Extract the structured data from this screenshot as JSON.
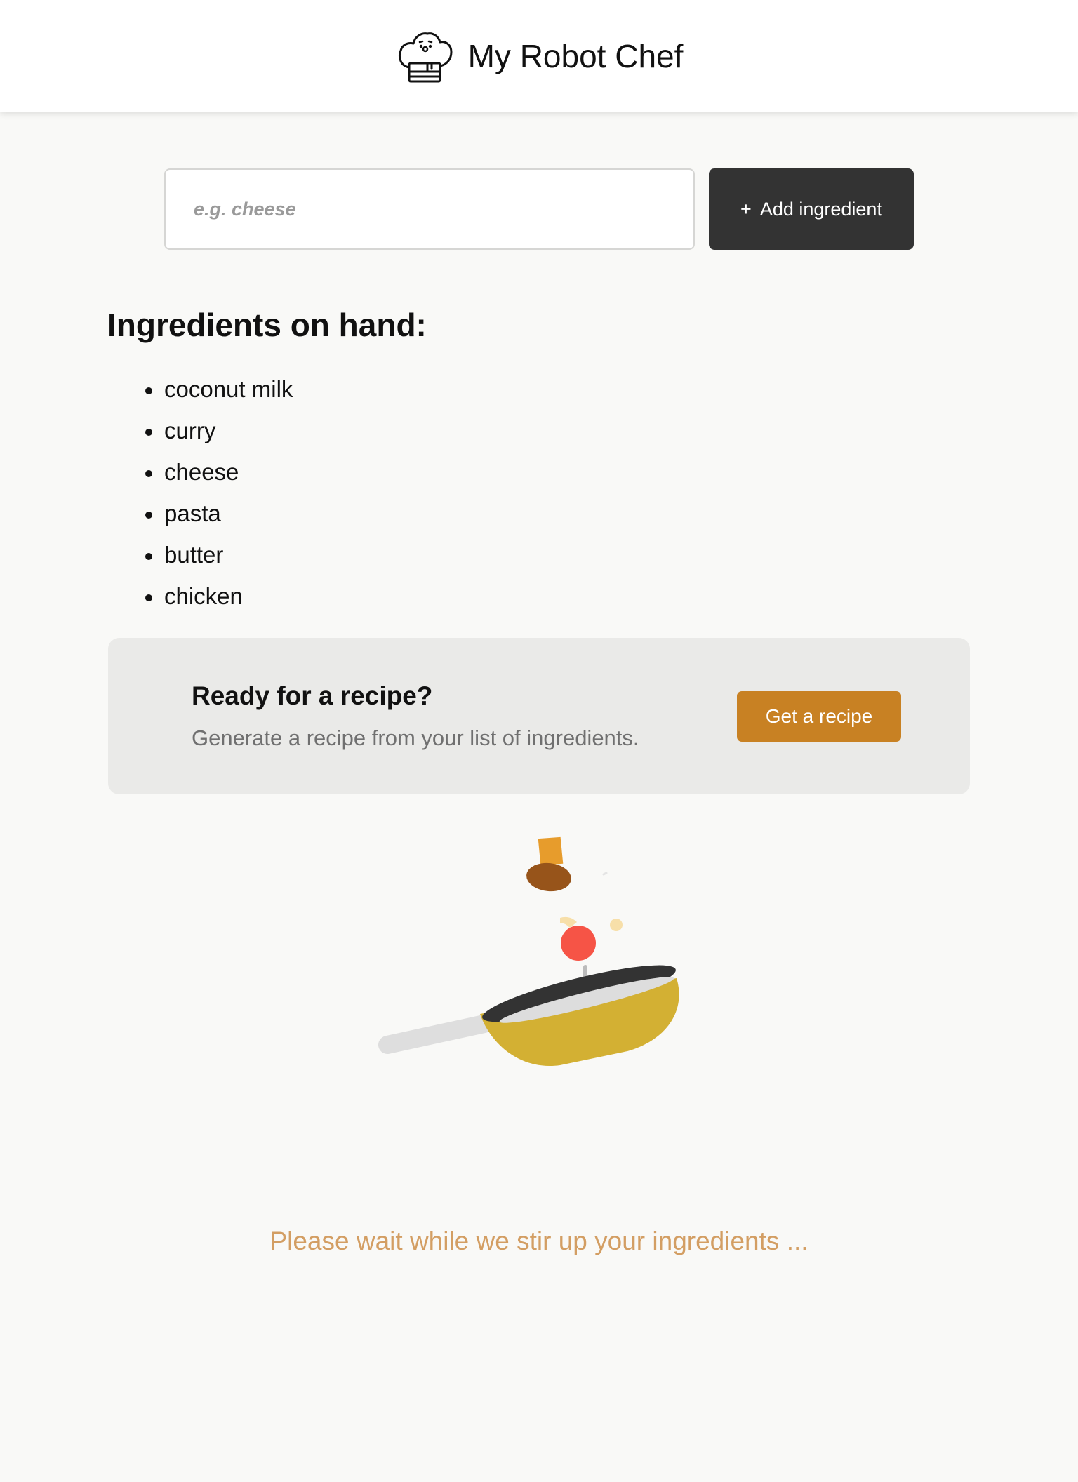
{
  "app": {
    "title": "My Robot Chef",
    "logo_icon": "chef-hat-icon"
  },
  "add_form": {
    "placeholder": "e.g. cheese",
    "value": "",
    "button_icon": "plus",
    "button_label": "Add ingredient"
  },
  "ingredients": {
    "heading": "Ingredients on hand:",
    "items": [
      "coconut milk",
      "curry",
      "cheese",
      "pasta",
      "butter",
      "chicken"
    ]
  },
  "recipe_card": {
    "title": "Ready for a recipe?",
    "subtitle": "Generate a recipe from your list of ingredients.",
    "button_label": "Get a recipe"
  },
  "loading": {
    "animation_icon": "frying-pan-icon",
    "message": "Please wait while we stir up your ingredients ..."
  },
  "colors": {
    "page_bg": "#f9f9f7",
    "header_bg": "#ffffff",
    "add_button_bg": "#333333",
    "recipe_button_bg": "#c88123",
    "card_bg": "#eaeae8",
    "loading_text": "#d39e63",
    "pan_body": "#d3b033"
  }
}
